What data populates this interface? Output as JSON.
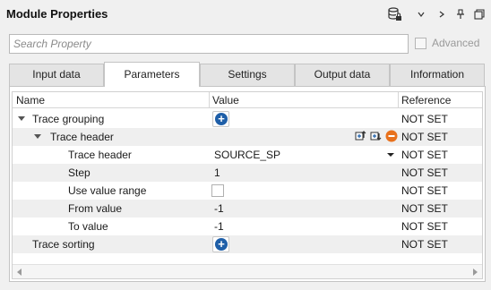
{
  "window": {
    "title": "Module Properties",
    "toolbar_icons": [
      "database-lock-icon",
      "chevron-down-icon",
      "chevron-right-icon",
      "pin-icon",
      "restore-window-icon"
    ]
  },
  "search": {
    "placeholder": "Search Property"
  },
  "advanced": {
    "label": "Advanced",
    "checked": false
  },
  "tabs": [
    {
      "label": "Input data",
      "active": false
    },
    {
      "label": "Parameters",
      "active": true
    },
    {
      "label": "Settings",
      "active": false
    },
    {
      "label": "Output data",
      "active": false
    },
    {
      "label": "Information",
      "active": false
    }
  ],
  "table": {
    "columns": [
      "Name",
      "Value",
      "Reference"
    ],
    "rows": [
      {
        "name": "Trace grouping",
        "value": "",
        "reference": "NOT SET",
        "level": 0,
        "expanded": true,
        "control": "add-button"
      },
      {
        "name": "Trace header",
        "value": "",
        "reference": "NOT SET",
        "level": 1,
        "expanded": true,
        "control": "row-actions"
      },
      {
        "name": "Trace header",
        "value": "SOURCE_SP",
        "reference": "NOT SET",
        "level": 2,
        "control": "dropdown"
      },
      {
        "name": "Step",
        "value": "1",
        "reference": "NOT SET",
        "level": 2,
        "control": "text"
      },
      {
        "name": "Use value range",
        "value": "",
        "reference": "NOT SET",
        "level": 2,
        "control": "checkbox",
        "checked": false
      },
      {
        "name": "From value",
        "value": "-1",
        "reference": "NOT SET",
        "level": 2,
        "control": "text"
      },
      {
        "name": "To value",
        "value": "-1",
        "reference": "NOT SET",
        "level": 2,
        "control": "text"
      },
      {
        "name": "Trace sorting",
        "value": "",
        "reference": "NOT SET",
        "level": 0,
        "control": "add-button"
      }
    ]
  },
  "colors": {
    "accent": "#1f5fa8",
    "remove": "#e8711c",
    "row_alt": "#efefef"
  }
}
